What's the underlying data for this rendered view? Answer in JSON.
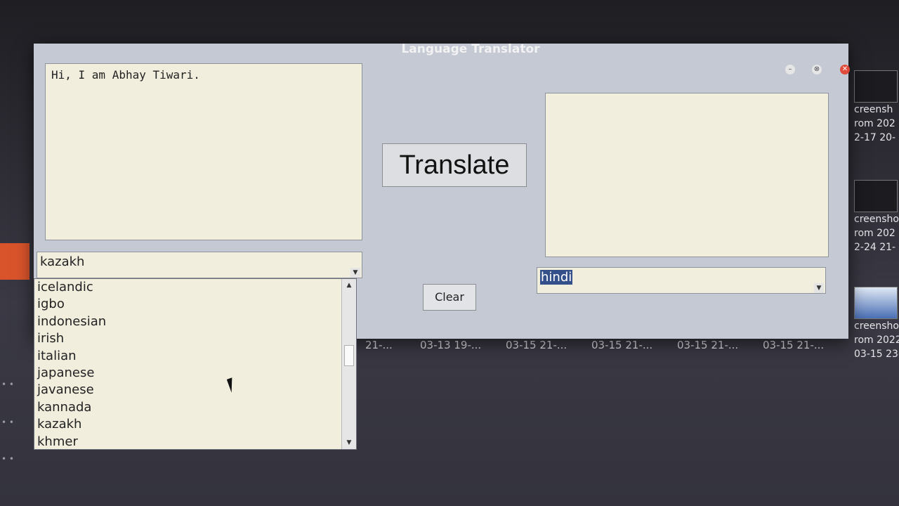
{
  "window": {
    "title": "Language Translator",
    "controls": {
      "minimize": "–",
      "maximize": "⊗",
      "close": "✕"
    }
  },
  "input_text": "Hi, I am Abhay Tiwari.",
  "output_text": "",
  "translate_label": "Translate",
  "clear_label": "Clear",
  "source_language": {
    "selected": "kazakh",
    "options": [
      "icelandic",
      "igbo",
      "indonesian",
      "irish",
      "italian",
      "japanese",
      "javanese",
      "kannada",
      "kazakh",
      "khmer"
    ]
  },
  "target_language": {
    "selected": "hindi"
  },
  "desktop": {
    "thumbnails": [
      {
        "caption1": "creensh",
        "caption2": "rom 202",
        "caption3": "2-17 20-"
      },
      {
        "caption1": "creensho",
        "caption2": "rom 202",
        "caption3": "2-24 21-"
      },
      {
        "caption1": "creensho",
        "caption2": "rom 2022",
        "caption3": "03-15 23-"
      }
    ],
    "bottom_labels": [
      "21-...",
      "03-13 19-...",
      "03-15 21-...",
      "03-15 21-...",
      "03-15 21-...",
      "03-15 21-..."
    ]
  },
  "colors": {
    "window_bg": "#c4c9d3",
    "field_bg": "#f1eede",
    "selection": "#33508a",
    "dock_accent": "#d9542b"
  }
}
